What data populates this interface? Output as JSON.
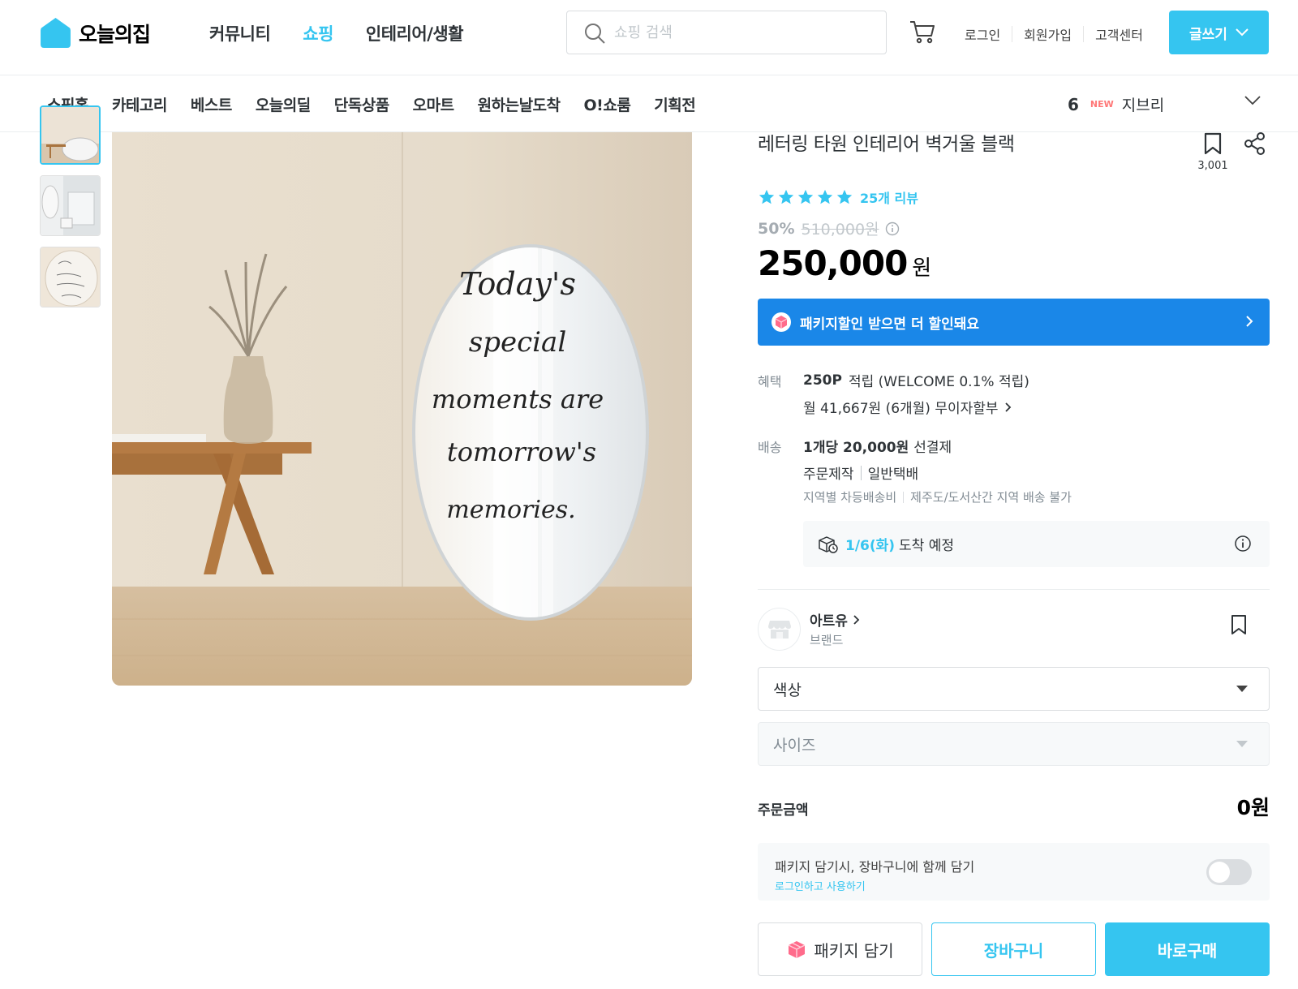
{
  "header": {
    "logo_text": "오늘의집",
    "gnb": [
      "커뮤니티",
      "쇼핑",
      "인테리어/생활"
    ],
    "active_gnb": "쇼핑",
    "search_placeholder": "쇼핑 검색",
    "util_links": [
      "로그인",
      "회원가입",
      "고객센터"
    ],
    "write_button": "글쓰기"
  },
  "category_nav": {
    "items": [
      "쇼핑홈",
      "카테고리",
      "베스트",
      "오늘의딜",
      "단독상품",
      "오마트",
      "원하는날도착",
      "O!쇼룸",
      "기획전"
    ],
    "ranking_number": "6",
    "ranking_badge": "NEW",
    "ranking_term": "지브리"
  },
  "product": {
    "title": "레터링 타원 인테리어 벽거울 블랙",
    "scrap_count": "3,001",
    "rating": 5,
    "review_count": "25개 리뷰",
    "discount_rate": "50%",
    "original_price": "510,000원",
    "price": "250,000",
    "price_unit": "원",
    "package_banner": "패키지할인 받으면 더 할인돼요",
    "mirror_text": [
      "Today's",
      "special",
      "moments are",
      "tomorrow's",
      "memories."
    ]
  },
  "benefit": {
    "label": "혜택",
    "points_bold": "250P",
    "points_text": "적립 (WELCOME 0.1% 적립)",
    "installment": "월 41,667원 (6개월) 무이자할부"
  },
  "delivery": {
    "label": "배송",
    "fee_bold": "1개당 20,000원",
    "fee_text": "선결제",
    "type_1": "주문제작",
    "type_2": "일반택배",
    "note_1": "지역별 차등배송비",
    "note_2": "제주도/도서산간 지역 배송 불가",
    "arrival_date": "1/6(화)",
    "arrival_text": "도착 예정"
  },
  "brand": {
    "name": "아트유",
    "type": "브랜드"
  },
  "options": {
    "color_label": "색상",
    "size_label": "사이즈"
  },
  "order": {
    "label": "주문금액",
    "amount": "0원"
  },
  "package_toggle": {
    "title": "패키지 담기시, 장바구니에 함께 담기",
    "link": "로그인하고 사용하기",
    "enabled": false
  },
  "actions": {
    "package": "패키지 담기",
    "cart": "장바구니",
    "buy": "바로구매"
  },
  "colors": {
    "accent": "#35c5f0",
    "banner": "#1a87e8",
    "text": "#2f3438",
    "muted": "#828c94"
  }
}
